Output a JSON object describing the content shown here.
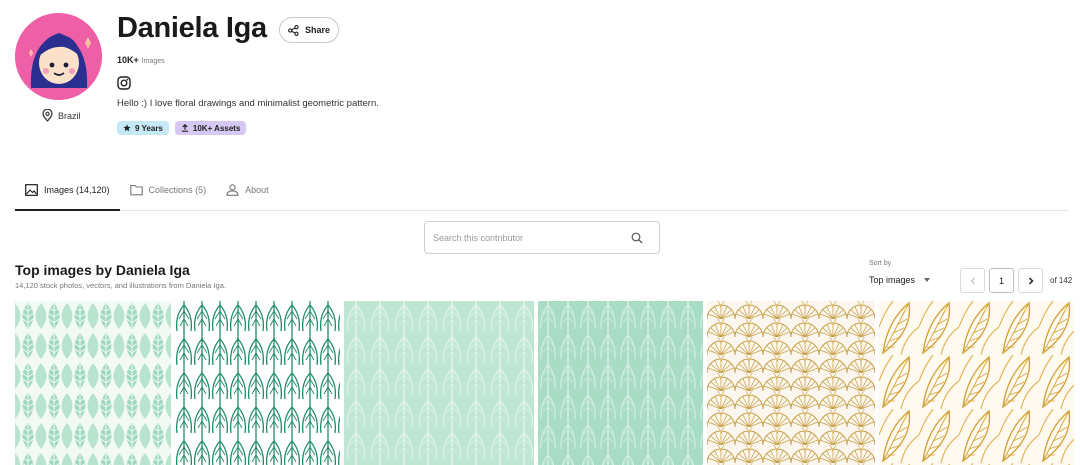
{
  "profile": {
    "name": "Daniela Iga",
    "share_label": "Share",
    "count_value": "10K+",
    "count_label": "Images",
    "bio": "Hello :) I love floral drawings and minimalist geometric pattern.",
    "location": "Brazil",
    "badges": [
      {
        "label": "9 Years",
        "icon": "star-icon",
        "color": "#c5e9f5"
      },
      {
        "label": "10K+ Assets",
        "icon": "upload-icon",
        "color": "#d6c8f3"
      }
    ],
    "avatar_color": "#ef5fa7",
    "social_icon": "instagram-icon"
  },
  "tabs": [
    {
      "label": "Images (14,120)",
      "icon": "image-icon",
      "active": true
    },
    {
      "label": "Collections (5)",
      "icon": "folder-icon",
      "active": false
    },
    {
      "label": "About",
      "icon": "user-icon",
      "active": false
    }
  ],
  "search": {
    "placeholder": "Search this contributor",
    "value": ""
  },
  "section": {
    "title": "Top images by Daniela Iga",
    "subtitle": "14,120 stock photos, vectors, and illustrations from Daniela Iga."
  },
  "sort": {
    "label": "Sort by",
    "selected": "Top images"
  },
  "pagination": {
    "current": "1",
    "total_text": "of 142"
  },
  "images": [
    {
      "pattern": "mint-hexagon-leaves",
      "color": "#8fd2b5"
    },
    {
      "pattern": "teal-line-leaves",
      "color": "#1f8c6a"
    },
    {
      "pattern": "mint-leaf-stripes",
      "color": "#aadcc6"
    },
    {
      "pattern": "mint-leaf-stripes",
      "color": "#9ad5bc"
    },
    {
      "pattern": "gold-fan-scales",
      "color": "#c9a14a"
    },
    {
      "pattern": "gold-leaves",
      "color": "#d4a23a"
    }
  ]
}
